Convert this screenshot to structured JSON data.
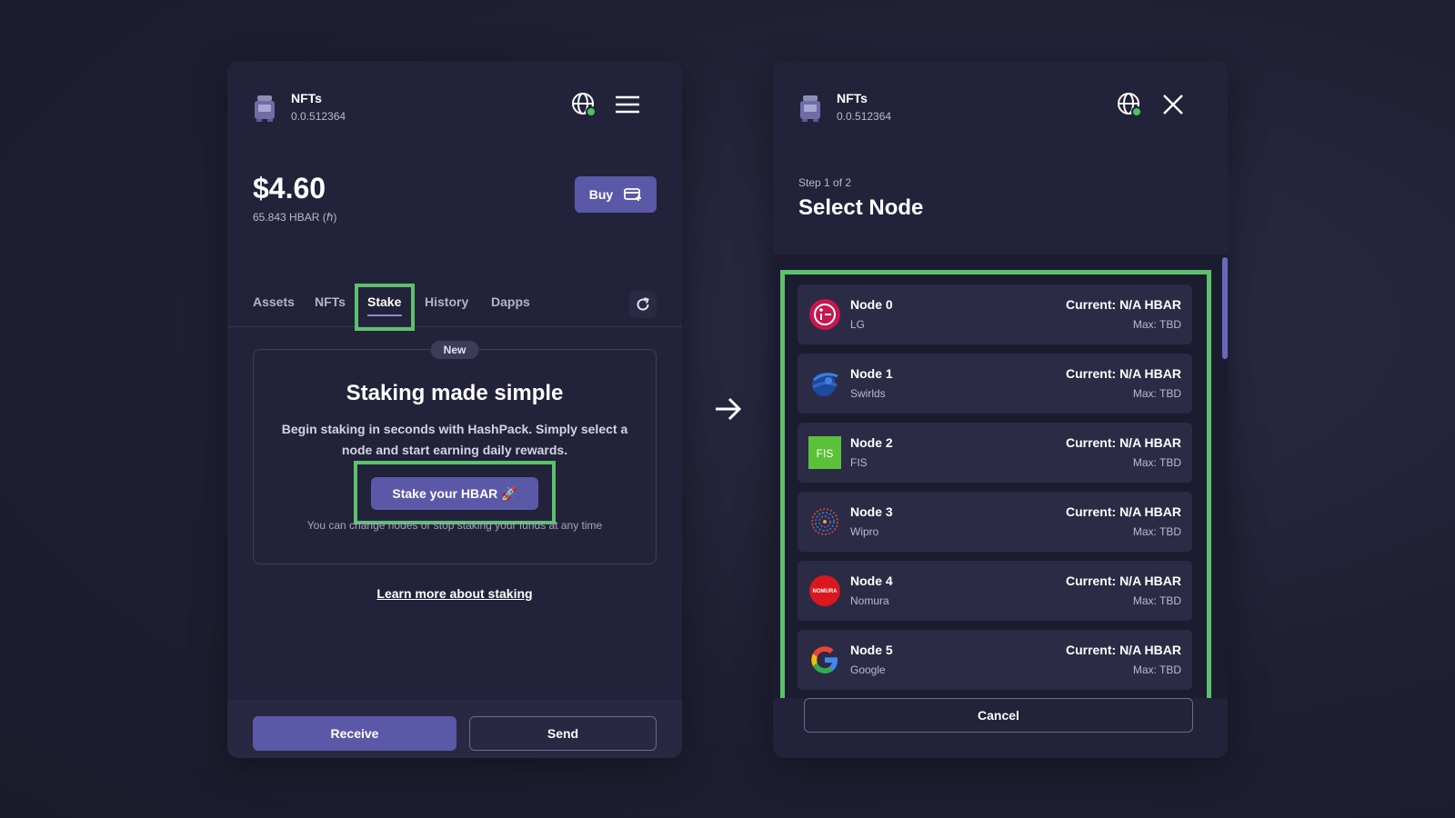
{
  "left": {
    "account": {
      "name": "NFTs",
      "id": "0.0.512364"
    },
    "balance": {
      "usd": "$4.60",
      "hbar": "65.843 HBAR (ℏ)"
    },
    "buy_label": "Buy",
    "tabs": [
      {
        "label": "Assets"
      },
      {
        "label": "NFTs"
      },
      {
        "label": "Stake"
      },
      {
        "label": "History"
      },
      {
        "label": "Dapps"
      }
    ],
    "active_tab": "Stake",
    "card": {
      "badge": "New",
      "title": "Staking made simple",
      "description": "Begin staking in seconds with HashPack. Simply select a node and start earning daily rewards.",
      "button_label": "Stake your HBAR 🚀",
      "note": "You can change nodes or stop staking your funds at any time"
    },
    "learn_more": "Learn more about staking",
    "receive_label": "Receive",
    "send_label": "Send"
  },
  "right": {
    "account": {
      "name": "NFTs",
      "id": "0.0.512364"
    },
    "step": "Step 1 of 2",
    "title": "Select Node",
    "nodes": [
      {
        "name": "Node 0",
        "org": "LG",
        "current": "Current: N/A HBAR",
        "max": "Max: TBD",
        "logo": "lg-logo"
      },
      {
        "name": "Node 1",
        "org": "Swirlds",
        "current": "Current: N/A HBAR",
        "max": "Max: TBD",
        "logo": "swirlds-logo"
      },
      {
        "name": "Node 2",
        "org": "FIS",
        "current": "Current: N/A HBAR",
        "max": "Max: TBD",
        "logo": "fis-logo"
      },
      {
        "name": "Node 3",
        "org": "Wipro",
        "current": "Current: N/A HBAR",
        "max": "Max: TBD",
        "logo": "wipro-logo"
      },
      {
        "name": "Node 4",
        "org": "Nomura",
        "current": "Current: N/A HBAR",
        "max": "Max: TBD",
        "logo": "nomura-logo"
      },
      {
        "name": "Node 5",
        "org": "Google",
        "current": "Current: N/A HBAR",
        "max": "Max: TBD",
        "logo": "google-logo"
      }
    ],
    "cancel_label": "Cancel"
  },
  "logo_text": {
    "fis": "FIS",
    "nomura": "NOMURA"
  },
  "colors": {
    "accent": "#5b58a8",
    "highlight": "#5cc16c",
    "panel": "#22223a"
  }
}
